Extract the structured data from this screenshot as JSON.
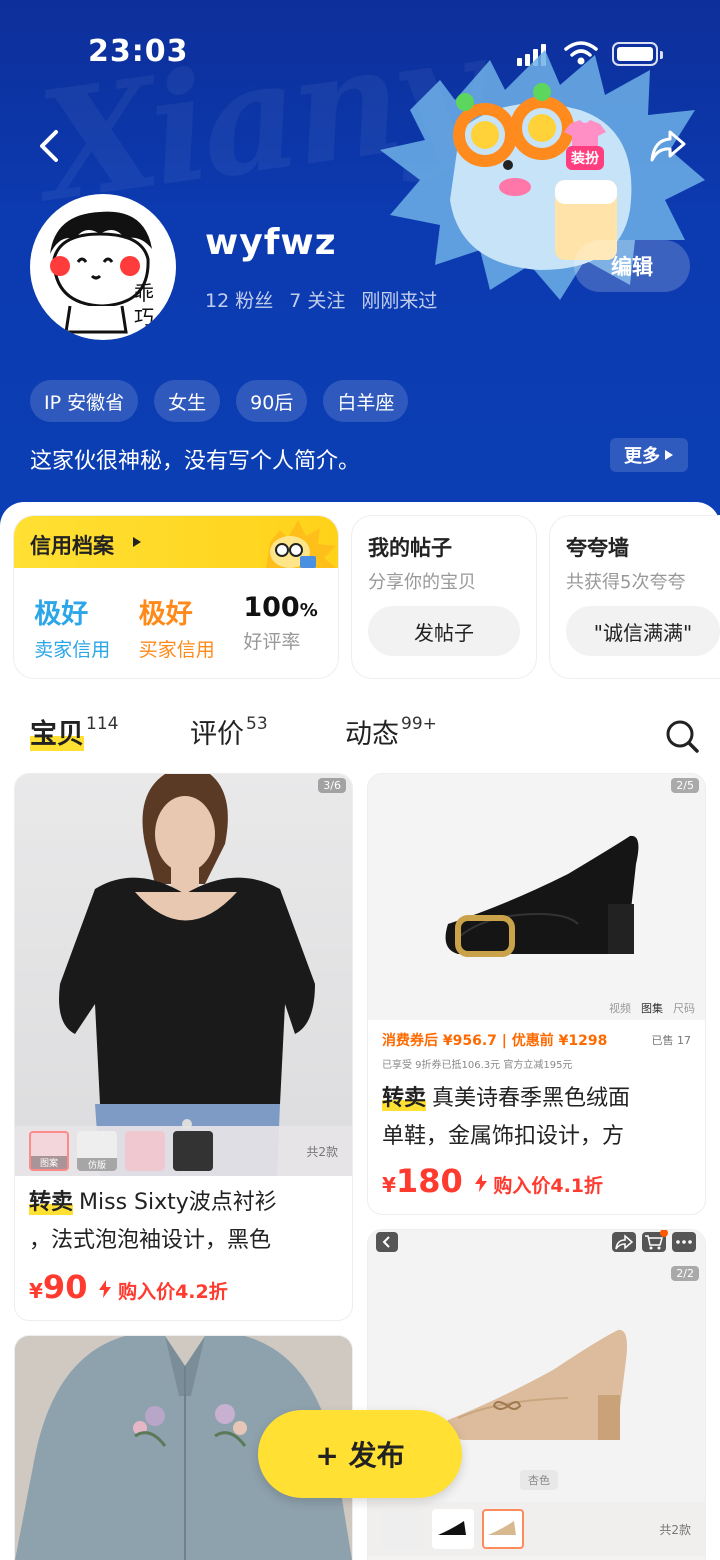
{
  "status": {
    "time": "23:03"
  },
  "header": {
    "watermark": "Xiany",
    "avatar_text": "乖巧",
    "dress_up": "装扮"
  },
  "profile": {
    "username": "wyfwz",
    "fans": "12 粉丝",
    "following": "7 关注",
    "last_seen": "刚刚来过",
    "edit_label": "编辑",
    "tags": [
      "IP 安徽省",
      "女生",
      "90后",
      "白羊座"
    ],
    "bio": "这家伙很神秘，没有写个人简介。",
    "more_label": "更多"
  },
  "credit": {
    "title": "信用档案",
    "seller": {
      "value": "极好",
      "label": "卖家信用",
      "color": "#2ba6e8"
    },
    "buyer": {
      "value": "极好",
      "label": "买家信用",
      "color": "#ff8a1a"
    },
    "rate": {
      "value": "100",
      "unit": "%",
      "label": "好评率"
    }
  },
  "posts": {
    "title": "我的帖子",
    "subtitle": "分享你的宝贝",
    "button": "发帖子"
  },
  "praise": {
    "title": "夸夸墙",
    "subtitle": "共获得5次夸夸",
    "button": "\"诚信满满\""
  },
  "tabs": [
    {
      "label": "宝贝",
      "count": "114"
    },
    {
      "label": "评价",
      "count": "53"
    },
    {
      "label": "动态",
      "count": "99+"
    }
  ],
  "items": [
    {
      "count": "3/6",
      "badge": "转卖",
      "title1": "Miss Sixty波点衬衫",
      "title2": "，法式泡泡袖设计，黑色",
      "currency": "¥",
      "price": "90",
      "discount": "购入价4.2折",
      "strip_tags": [
        "图案",
        "仿版"
      ],
      "strip_more": "共2款"
    },
    {
      "count": "2/5",
      "badge": "转卖",
      "title1": "真美诗春季黑色绒面",
      "title2": "单鞋，金属饰扣设计，方",
      "currency": "¥",
      "price": "180",
      "discount": "购入价4.1折",
      "promo_a": "消费券后 ¥956.7 | 优惠前 ¥1298",
      "promo_sold": "已售 17",
      "promo_b": "已享受 9折券已抵106.3元   官方立减195元",
      "nav_a": "视频",
      "nav_b": "图集",
      "nav_c": "尺码"
    },
    {
      "count": "2/2",
      "color_label": "杏色",
      "strip_more": "共2款"
    },
    {}
  ],
  "fab": {
    "label": "+ 发布"
  },
  "colors": {
    "accent": "#ffe033",
    "price": "#ff3b30",
    "header": "#0c3ab0"
  }
}
